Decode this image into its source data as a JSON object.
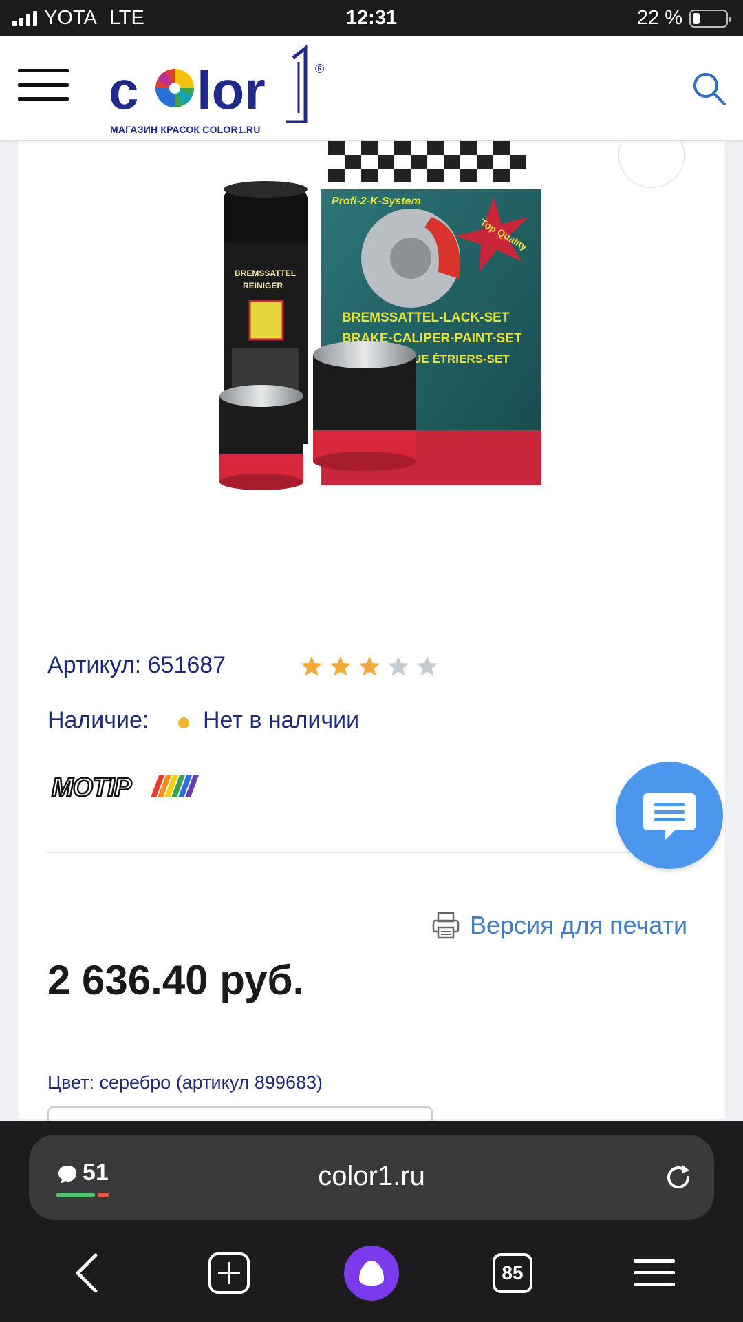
{
  "status_bar": {
    "carrier": "YOTA",
    "network": "LTE",
    "time": "12:31",
    "battery": "22 %",
    "battery_level": 0.22
  },
  "header": {
    "logo_text": "color1",
    "logo_trademark": "®",
    "logo_tagline": "МАГАЗИН КРАСОК COLOR1.RU",
    "brand_color": "#1f2a8a"
  },
  "product": {
    "image_texts": {
      "can_label_1": "BREMSSATTEL",
      "can_label_2": "REINIGER",
      "box_line_1": "BREMSSATTEL-LACK-SET",
      "box_line_2": "BRAKE-CALIPER-PAINT-SET",
      "box_line_3": "FREINS LAQUE ÉTRIERS-SET",
      "box_badge": "Top Quality",
      "box_corner": "Profi-2-K-System"
    },
    "sku_label": "Артикул: 651687",
    "rating": 3,
    "rating_max": 5,
    "availability_label": "Наличие:",
    "availability_value": "Нет в наличии",
    "availability_color": "#f0b62e",
    "brand_logo_text": "MOTIP",
    "print_label": "Версия для печати",
    "price": "2 636.40 руб.",
    "color_label": "Цвет: серебро (артикул 899683)",
    "link_color": "#3f7fc4",
    "text_color": "#1e2a78"
  },
  "browser": {
    "comments_count": "51",
    "url": "color1.ru",
    "tabs_count": "85"
  }
}
